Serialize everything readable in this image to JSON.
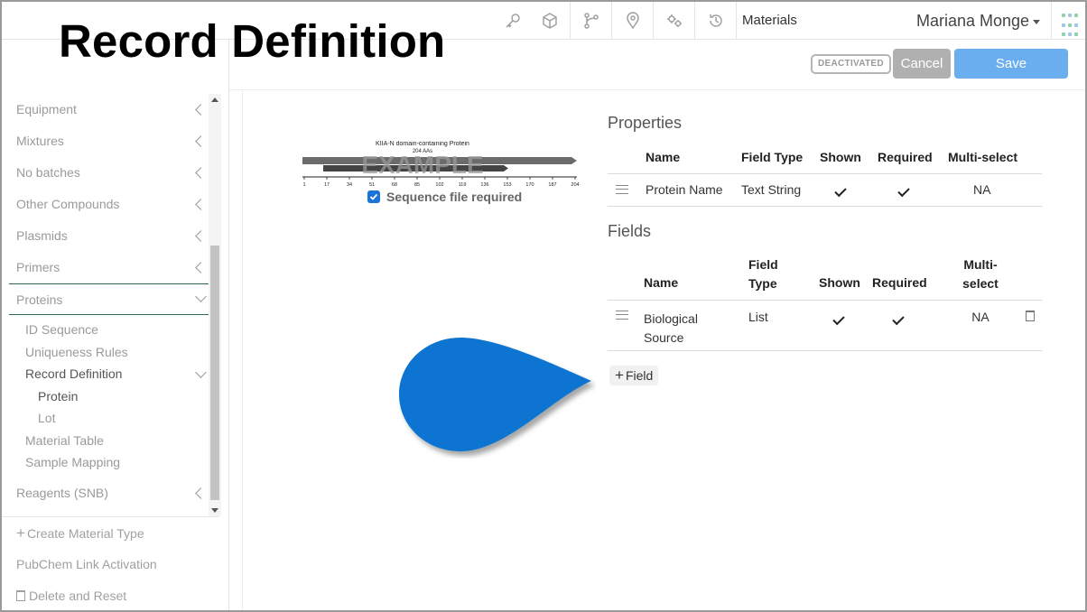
{
  "overlay": {
    "title": "Record Definition"
  },
  "topbar": {
    "icons": [
      "key-icon",
      "cube-icon",
      "branch-icon",
      "location-pin-icon",
      "gears-icon",
      "history-icon"
    ],
    "module": "Materials",
    "user": "Mariana Monge",
    "apps_icon": "apps-grid-icon"
  },
  "actionbar": {
    "status_badge": "DEACTIVATED",
    "cancel_label": "Cancel",
    "save_label": "Save"
  },
  "sidebar": {
    "items": [
      {
        "label": "Equipment"
      },
      {
        "label": "Mixtures"
      },
      {
        "label": "No batches"
      },
      {
        "label": "Other Compounds"
      },
      {
        "label": "Plasmids"
      },
      {
        "label": "Primers"
      },
      {
        "label": "Proteins"
      }
    ],
    "sub_items": [
      {
        "label": "ID Sequence"
      },
      {
        "label": "Uniqueness Rules"
      },
      {
        "label": "Record Definition"
      },
      {
        "label": "Protein"
      },
      {
        "label": "Lot"
      },
      {
        "label": "Material Table"
      },
      {
        "label": "Sample Mapping"
      }
    ],
    "after_items": [
      {
        "label": "Reagents (SNB)"
      }
    ],
    "bottom": {
      "create": "Create Material Type",
      "pubchem": "PubChem Link Activation",
      "delete": "Delete and Reset"
    }
  },
  "preview": {
    "protein_title": "KIIA-N domain-containing Protein",
    "protein_length": "204 AAs",
    "watermark": "EXAMPLE",
    "ticks": [
      "1",
      "17",
      "34",
      "51",
      "68",
      "85",
      "102",
      "119",
      "136",
      "153",
      "170",
      "187",
      "204"
    ],
    "sequence_required_label": "Sequence file required",
    "sequence_required_checked": true
  },
  "properties": {
    "title": "Properties",
    "headers": {
      "name": "Name",
      "type": "Field Type",
      "shown": "Shown",
      "required": "Required",
      "multi": "Multi-select"
    },
    "rows": [
      {
        "name": "Protein Name",
        "type": "Text String",
        "shown": true,
        "required": true,
        "multi": "NA"
      }
    ]
  },
  "fields": {
    "title": "Fields",
    "headers": {
      "name": "Name",
      "type_line1": "Field",
      "type_line2": "Type",
      "shown": "Shown",
      "required": "Required",
      "multi_line1": "Multi-",
      "multi_line2": "select"
    },
    "rows": [
      {
        "name_line1": "Biological",
        "name_line2": "Source",
        "type": "List",
        "shown": true,
        "required": true,
        "multi": "NA"
      }
    ],
    "add_label": "Field"
  },
  "colors": {
    "accent": "#1a73d9",
    "save": "#6aaef0",
    "cancel": "#b0b0b0",
    "pointer": "#0b74d1",
    "sidebar_active_border": "#2d6a4f"
  }
}
